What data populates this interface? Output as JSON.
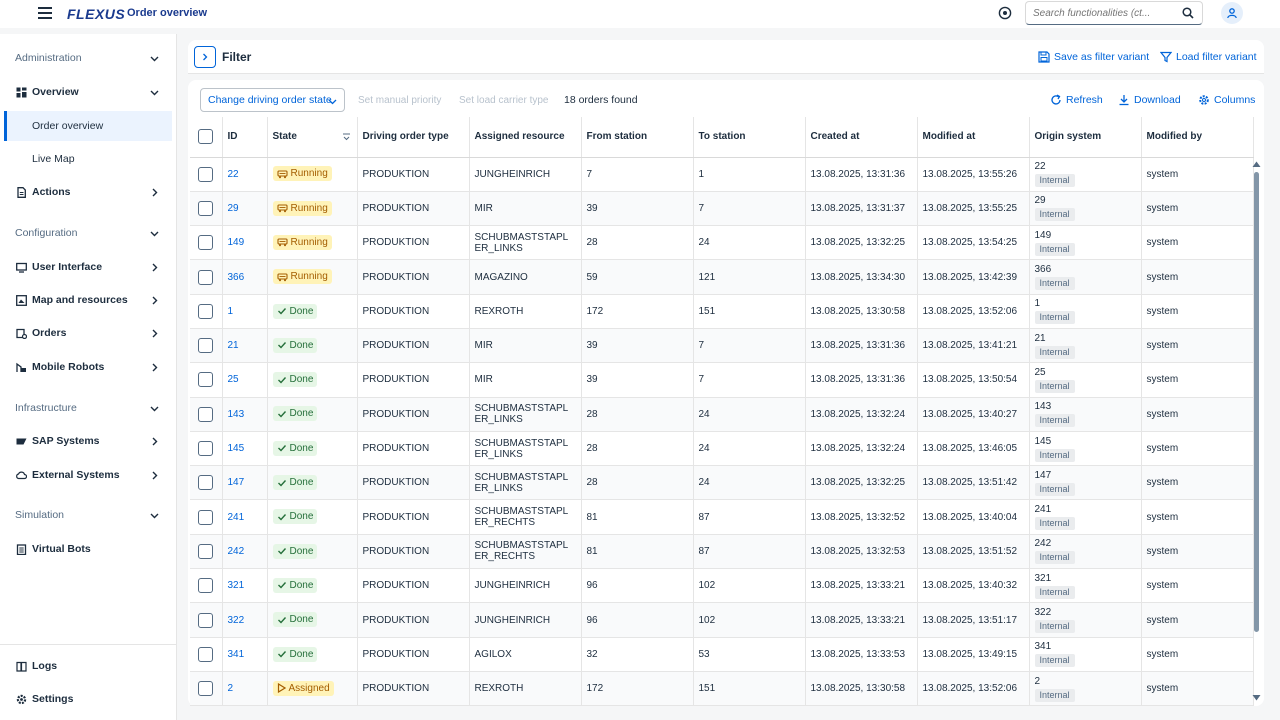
{
  "header": {
    "brand": "FLEXUS",
    "title": "Order overview",
    "search_placeholder": "Search functionalities (ct..."
  },
  "sidebar": {
    "groups": [
      {
        "label": "Administration"
      },
      {
        "label": "Configuration"
      },
      {
        "label": "Infrastructure"
      },
      {
        "label": "Simulation"
      }
    ],
    "items": {
      "overview": "Overview",
      "order_overview": "Order overview",
      "live_map": "Live Map",
      "actions": "Actions",
      "user_interface": "User Interface",
      "map_resources": "Map and resources",
      "orders": "Orders",
      "mobile_robots": "Mobile Robots",
      "sap_systems": "SAP Systems",
      "external_systems": "External Systems",
      "virtual_bots": "Virtual Bots",
      "logs": "Logs",
      "settings": "Settings"
    }
  },
  "filter": {
    "title": "Filter",
    "save_variant": "Save as filter variant",
    "load_variant": "Load filter variant"
  },
  "toolbar": {
    "change_state": "Change driving order state",
    "set_priority": "Set manual priority",
    "set_carrier": "Set load carrier type",
    "count": "18 orders found",
    "refresh": "Refresh",
    "download": "Download",
    "columns": "Columns"
  },
  "table": {
    "columns": [
      "ID",
      "State",
      "Driving order type",
      "Assigned resource",
      "From station",
      "To station",
      "Created at",
      "Modified at",
      "Origin system",
      "Modified by"
    ],
    "origin_tag": "Internal",
    "rows": [
      {
        "id": "22",
        "state": "Running",
        "state_kind": "running",
        "type": "PRODUKTION",
        "resource": "JUNGHEINRICH",
        "from": "7",
        "to": "1",
        "created": "13.08.2025, 13:31:36",
        "modified": "13.08.2025, 13:55:26",
        "origin": "22",
        "by": "system"
      },
      {
        "id": "29",
        "state": "Running",
        "state_kind": "running",
        "type": "PRODUKTION",
        "resource": "MIR",
        "from": "39",
        "to": "7",
        "created": "13.08.2025, 13:31:37",
        "modified": "13.08.2025, 13:55:25",
        "origin": "29",
        "by": "system"
      },
      {
        "id": "149",
        "state": "Running",
        "state_kind": "running",
        "type": "PRODUKTION",
        "resource": "SCHUBMASTSTAPLER_LINKS",
        "from": "28",
        "to": "24",
        "created": "13.08.2025, 13:32:25",
        "modified": "13.08.2025, 13:54:25",
        "origin": "149",
        "by": "system"
      },
      {
        "id": "366",
        "state": "Running",
        "state_kind": "running",
        "type": "PRODUKTION",
        "resource": "MAGAZINO",
        "from": "59",
        "to": "121",
        "created": "13.08.2025, 13:34:30",
        "modified": "13.08.2025, 13:42:39",
        "origin": "366",
        "by": "system"
      },
      {
        "id": "1",
        "state": "Done",
        "state_kind": "done",
        "type": "PRODUKTION",
        "resource": "REXROTH",
        "from": "172",
        "to": "151",
        "created": "13.08.2025, 13:30:58",
        "modified": "13.08.2025, 13:52:06",
        "origin": "1",
        "by": "system"
      },
      {
        "id": "21",
        "state": "Done",
        "state_kind": "done",
        "type": "PRODUKTION",
        "resource": "MIR",
        "from": "39",
        "to": "7",
        "created": "13.08.2025, 13:31:36",
        "modified": "13.08.2025, 13:41:21",
        "origin": "21",
        "by": "system"
      },
      {
        "id": "25",
        "state": "Done",
        "state_kind": "done",
        "type": "PRODUKTION",
        "resource": "MIR",
        "from": "39",
        "to": "7",
        "created": "13.08.2025, 13:31:36",
        "modified": "13.08.2025, 13:50:54",
        "origin": "25",
        "by": "system"
      },
      {
        "id": "143",
        "state": "Done",
        "state_kind": "done",
        "type": "PRODUKTION",
        "resource": "SCHUBMASTSTAPLER_LINKS",
        "from": "28",
        "to": "24",
        "created": "13.08.2025, 13:32:24",
        "modified": "13.08.2025, 13:40:27",
        "origin": "143",
        "by": "system"
      },
      {
        "id": "145",
        "state": "Done",
        "state_kind": "done",
        "type": "PRODUKTION",
        "resource": "SCHUBMASTSTAPLER_LINKS",
        "from": "28",
        "to": "24",
        "created": "13.08.2025, 13:32:24",
        "modified": "13.08.2025, 13:46:05",
        "origin": "145",
        "by": "system"
      },
      {
        "id": "147",
        "state": "Done",
        "state_kind": "done",
        "type": "PRODUKTION",
        "resource": "SCHUBMASTSTAPLER_LINKS",
        "from": "28",
        "to": "24",
        "created": "13.08.2025, 13:32:25",
        "modified": "13.08.2025, 13:51:42",
        "origin": "147",
        "by": "system"
      },
      {
        "id": "241",
        "state": "Done",
        "state_kind": "done",
        "type": "PRODUKTION",
        "resource": "SCHUBMASTSTAPLER_RECHTS",
        "from": "81",
        "to": "87",
        "created": "13.08.2025, 13:32:52",
        "modified": "13.08.2025, 13:40:04",
        "origin": "241",
        "by": "system"
      },
      {
        "id": "242",
        "state": "Done",
        "state_kind": "done",
        "type": "PRODUKTION",
        "resource": "SCHUBMASTSTAPLER_RECHTS",
        "from": "81",
        "to": "87",
        "created": "13.08.2025, 13:32:53",
        "modified": "13.08.2025, 13:51:52",
        "origin": "242",
        "by": "system"
      },
      {
        "id": "321",
        "state": "Done",
        "state_kind": "done",
        "type": "PRODUKTION",
        "resource": "JUNGHEINRICH",
        "from": "96",
        "to": "102",
        "created": "13.08.2025, 13:33:21",
        "modified": "13.08.2025, 13:40:32",
        "origin": "321",
        "by": "system"
      },
      {
        "id": "322",
        "state": "Done",
        "state_kind": "done",
        "type": "PRODUKTION",
        "resource": "JUNGHEINRICH",
        "from": "96",
        "to": "102",
        "created": "13.08.2025, 13:33:21",
        "modified": "13.08.2025, 13:51:17",
        "origin": "322",
        "by": "system"
      },
      {
        "id": "341",
        "state": "Done",
        "state_kind": "done",
        "type": "PRODUKTION",
        "resource": "AGILOX",
        "from": "32",
        "to": "53",
        "created": "13.08.2025, 13:33:53",
        "modified": "13.08.2025, 13:49:15",
        "origin": "341",
        "by": "system"
      },
      {
        "id": "2",
        "state": "Assigned",
        "state_kind": "assigned",
        "type": "PRODUKTION",
        "resource": "REXROTH",
        "from": "172",
        "to": "151",
        "created": "13.08.2025, 13:30:58",
        "modified": "13.08.2025, 13:52:06",
        "origin": "2",
        "by": "system"
      }
    ]
  },
  "colors": {
    "brand": "#1a3a8e",
    "link": "#0064d9",
    "running_bg": "#fff3b8",
    "done_bg": "#e6f6e6"
  }
}
